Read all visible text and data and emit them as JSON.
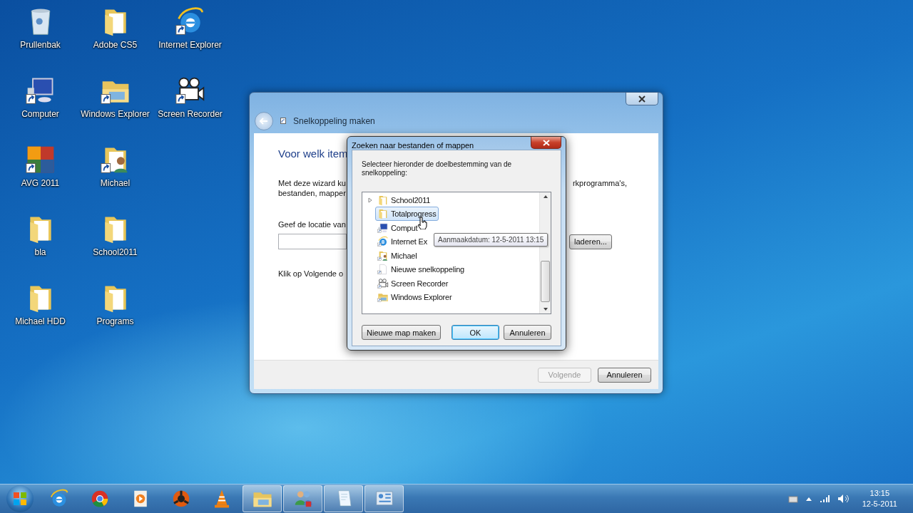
{
  "desktop_icons": [
    {
      "label": "Prullenbak",
      "kind": "bin",
      "shortcut": false
    },
    {
      "label": "Computer",
      "kind": "computer",
      "shortcut": true
    },
    {
      "label": "AVG 2011",
      "kind": "avg",
      "shortcut": true
    },
    {
      "label": "bla",
      "kind": "folder",
      "shortcut": false
    },
    {
      "label": "Michael HDD",
      "kind": "folder",
      "shortcut": false
    },
    {
      "label": "Adobe CS5",
      "kind": "folder",
      "shortcut": false
    },
    {
      "label": "Windows Explorer",
      "kind": "explorer",
      "shortcut": true
    },
    {
      "label": "Michael",
      "kind": "user",
      "shortcut": true
    },
    {
      "label": "School2011",
      "kind": "folder",
      "shortcut": false
    },
    {
      "label": "Programs",
      "kind": "folder",
      "shortcut": false
    },
    {
      "label": "Internet Explorer",
      "kind": "ie",
      "shortcut": true
    },
    {
      "label": "Screen Recorder",
      "kind": "recorder",
      "shortcut": true
    }
  ],
  "wizard": {
    "title": "Snelkoppeling maken",
    "heading": "Voor welk item",
    "intro_left": [
      "Met deze wizard ku",
      "bestanden, mapper"
    ],
    "intro_right": "rkprogramma's,",
    "location_label": "Geef de locatie van",
    "browse_button": "laderen...",
    "hint": "Klik op Volgende o",
    "buttons": [
      {
        "label": "Volgende",
        "disabled": true
      },
      {
        "label": "Annuleren",
        "disabled": false
      }
    ]
  },
  "dialog": {
    "title": "Zoeken naar bestanden of mappen",
    "instruction": "Selecteer hieronder de doelbestemming van de snelkoppeling:",
    "tree": [
      {
        "label": "School2011",
        "kind": "folder",
        "expandable": true,
        "selected": false
      },
      {
        "label": "Totalprogress",
        "kind": "folder",
        "expandable": false,
        "selected": true
      },
      {
        "label": "Comput",
        "kind": "computer",
        "expandable": false,
        "selected": false
      },
      {
        "label": "Internet Ex",
        "kind": "ie",
        "expandable": false,
        "selected": false
      },
      {
        "label": "Michael",
        "kind": "user",
        "expandable": false,
        "selected": false
      },
      {
        "label": "Nieuwe snelkoppeling",
        "kind": "doc",
        "expandable": false,
        "selected": false
      },
      {
        "label": "Screen Recorder",
        "kind": "recorder",
        "expandable": false,
        "selected": false
      },
      {
        "label": "Windows Explorer",
        "kind": "explorer",
        "expandable": false,
        "selected": false
      }
    ],
    "tooltip": "Aanmaakdatum: 12-5-2011 13:15",
    "buttons": [
      {
        "label": "Nieuwe map maken",
        "default": false
      },
      {
        "label": "OK",
        "default": true
      },
      {
        "label": "Annuleren",
        "default": false
      }
    ]
  },
  "taskbar": {
    "items": [
      {
        "kind": "ie",
        "running": false
      },
      {
        "kind": "chrome",
        "running": false
      },
      {
        "kind": "media",
        "running": false
      },
      {
        "kind": "reason",
        "running": false
      },
      {
        "kind": "vlc",
        "running": false
      },
      {
        "kind": "explorer",
        "running": true
      },
      {
        "kind": "people",
        "running": true
      },
      {
        "kind": "notepad",
        "running": true
      },
      {
        "kind": "control",
        "running": true
      }
    ],
    "clock": {
      "time": "13:15",
      "date": "12-5-2011"
    }
  }
}
